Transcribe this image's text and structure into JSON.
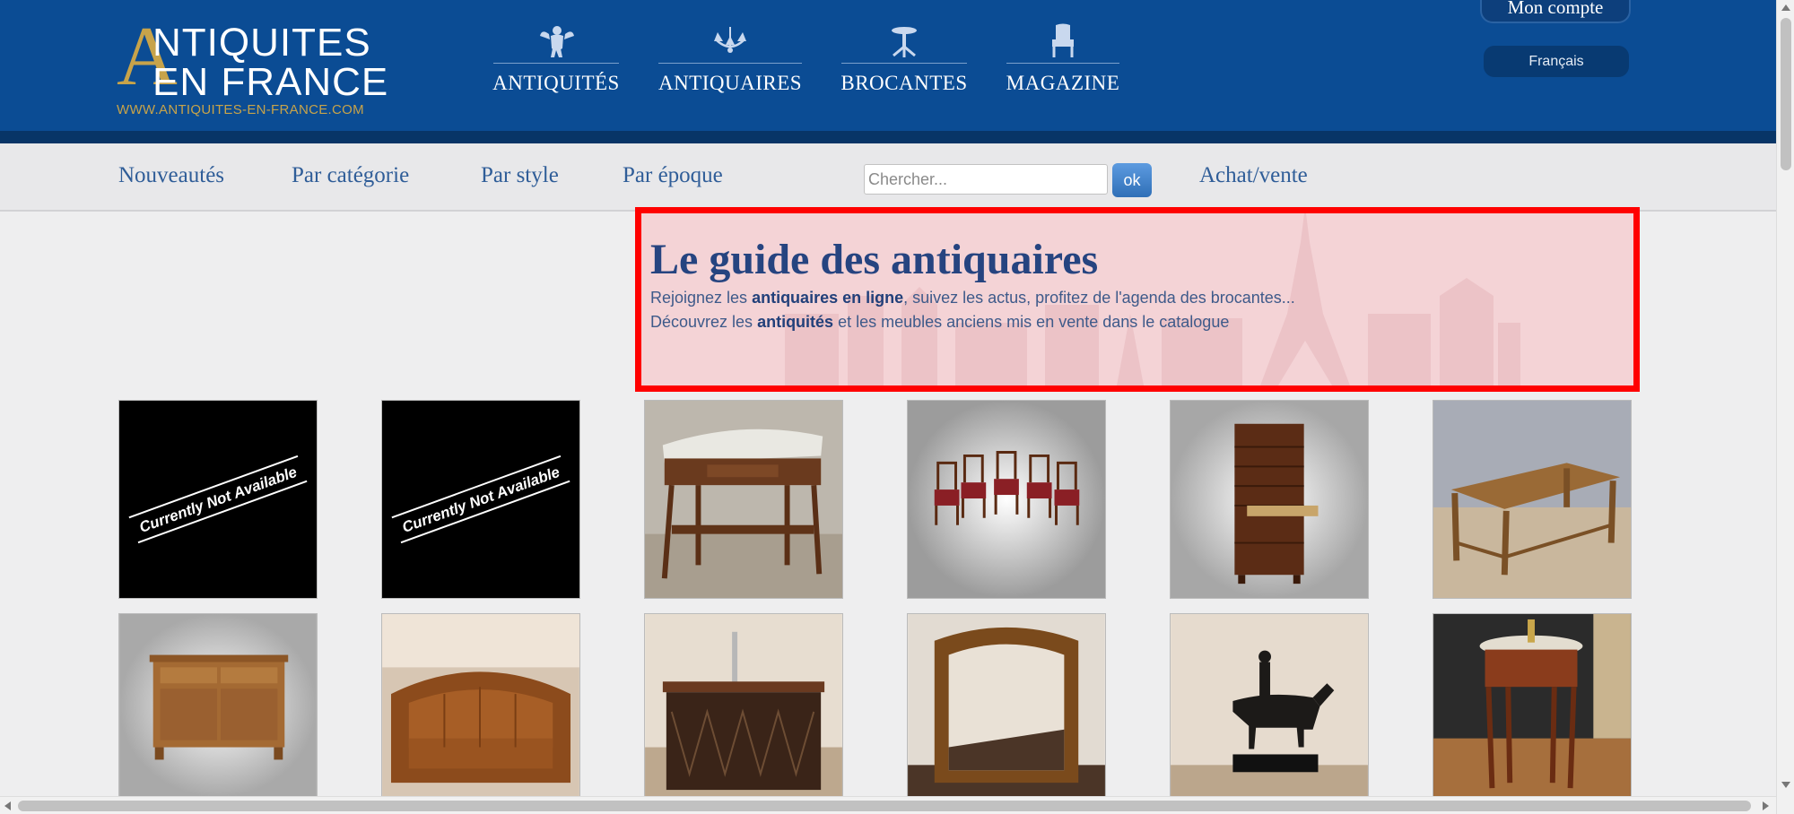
{
  "header": {
    "logo": {
      "big_letter": "A",
      "line1": "NTIQUITES",
      "line2": "EN FRANCE",
      "url": "WWW.ANTIQUITES-EN-FRANCE.COM"
    },
    "nav": [
      {
        "label": "ANTIQUITÉS",
        "icon": "cherub-icon"
      },
      {
        "label": "ANTIQUAIRES",
        "icon": "chandelier-icon"
      },
      {
        "label": "BROCANTES",
        "icon": "gueridon-table-icon"
      },
      {
        "label": "MAGAZINE",
        "icon": "armchair-icon"
      }
    ],
    "account_label": "Mon compte",
    "language_label": "Français"
  },
  "subnav": {
    "links": [
      "Nouveautés",
      "Par catégorie",
      "Par style",
      "Par époque"
    ],
    "search_placeholder": "Chercher...",
    "search_button": "ok",
    "trade_link": "Achat/vente"
  },
  "hero": {
    "title": "Le guide des antiquaires",
    "line1_pre": "Rejoignez les ",
    "line1_bold": "antiquaires en ligne",
    "line1_post": ", suivez les actus, profitez de l'agenda des brocantes...",
    "line2_pre": "Découvrez les ",
    "line2_bold": "antiquités",
    "line2_post": " et les meubles anciens mis en vente dans le catalogue"
  },
  "products": {
    "placeholder_text": "Currently Not Available",
    "items": [
      {
        "kind": "not-available"
      },
      {
        "kind": "not-available"
      },
      {
        "kind": "side-table-marble"
      },
      {
        "kind": "chairs-set"
      },
      {
        "kind": "secretary-cabinet"
      },
      {
        "kind": "farm-table"
      },
      {
        "kind": "sideboard"
      },
      {
        "kind": "leather-sofa"
      },
      {
        "kind": "bar-counter"
      },
      {
        "kind": "gilt-mirror"
      },
      {
        "kind": "bronze-horse-rider"
      },
      {
        "kind": "round-side-table"
      }
    ]
  },
  "colors": {
    "header_blue": "#0b4c94",
    "gold": "#c7a34a",
    "link_blue": "#2f5d98",
    "highlight_red": "#ff0000"
  }
}
